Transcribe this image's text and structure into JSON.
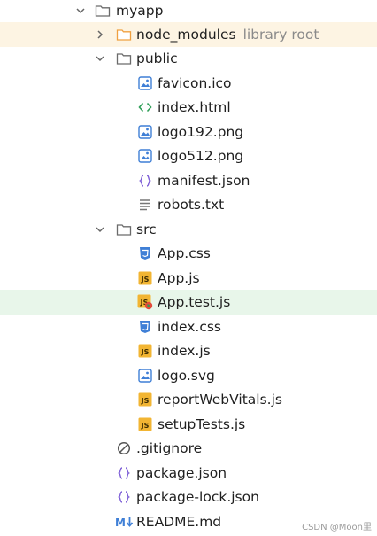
{
  "tree": {
    "myapp": "myapp",
    "node_modules": "node_modules",
    "node_modules_hint": "library root",
    "public": "public",
    "public_files": [
      "favicon.ico",
      "index.html",
      "logo192.png",
      "logo512.png",
      "manifest.json",
      "robots.txt"
    ],
    "src": "src",
    "src_files": [
      "App.css",
      "App.js",
      "App.test.js",
      "index.css",
      "index.js",
      "logo.svg",
      "reportWebVitals.js",
      "setupTests.js"
    ],
    "root_files": [
      ".gitignore",
      "package.json",
      "package-lock.json",
      "README.md"
    ]
  },
  "icons": {
    "folder": "folder-icon",
    "image": "image-icon",
    "html": "html-icon",
    "json": "json-icon",
    "text": "text-icon",
    "css": "css-icon",
    "js": "js-icon",
    "test": "test-js-icon",
    "ignore": "gitignore-icon",
    "markdown": "markdown-icon"
  },
  "colors": {
    "selected_row_orange": "#fdf4e3",
    "selected_row_green": "#e8f6ea",
    "folder_stroke": "#6b6b6b",
    "node_modules_folder": "#f0a040",
    "image_icon": "#3f7fd6",
    "html_icon": "#2e9e57",
    "json_icon": "#7b5bd6",
    "css_icon": "#3f7fd6",
    "js_icon": "#f2b533"
  },
  "watermark": "CSDN @Moon里"
}
